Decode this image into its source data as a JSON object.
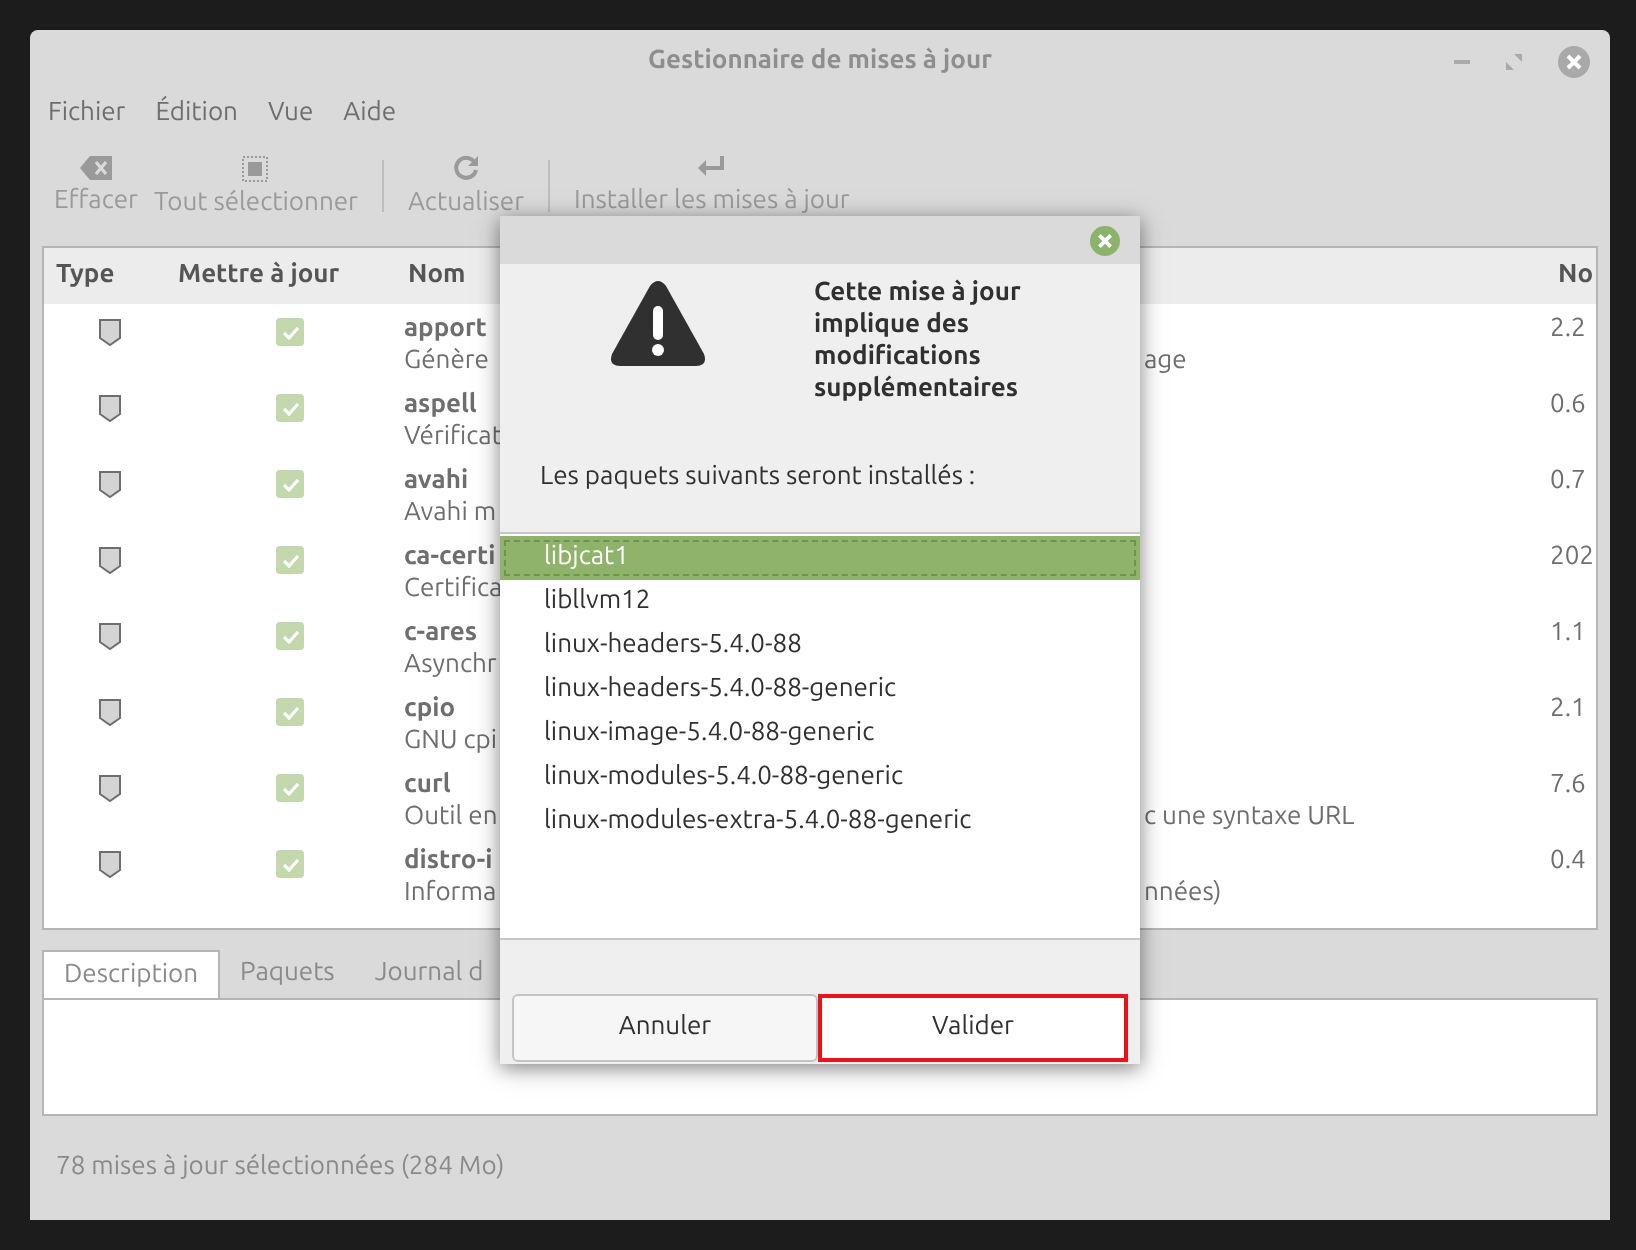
{
  "window": {
    "title": "Gestionnaire de mises à jour"
  },
  "menu": [
    "Fichier",
    "Édition",
    "Vue",
    "Aide"
  ],
  "toolbar": [
    "Effacer",
    "Tout sélectionner",
    "Actualiser",
    "Installer les mises à jour"
  ],
  "table": {
    "columns": [
      "Type",
      "Mettre à jour",
      "Nom",
      "No"
    ],
    "rows": [
      {
        "name": "apport",
        "description": "Génère",
        "description_tail": "age",
        "version": "2.2",
        "checked": true
      },
      {
        "name": "aspell",
        "description": "Vérificat",
        "version": "0.6",
        "checked": true
      },
      {
        "name": "avahi",
        "description": "Avahi m",
        "version": "0.7",
        "checked": true
      },
      {
        "name": "ca-certi",
        "description": "Certifica",
        "version": "202",
        "checked": true
      },
      {
        "name": "c-ares",
        "description": "Asynchr",
        "version": "1.1",
        "checked": true
      },
      {
        "name": "cpio",
        "description": "GNU cpi",
        "version": "2.1",
        "checked": true
      },
      {
        "name": "curl",
        "description": "Outil en",
        "description_tail": "c une syntaxe URL",
        "version": "7.6",
        "checked": true
      },
      {
        "name": "distro-i",
        "description": "Informa",
        "description_tail": "nnées)",
        "version": "0.4",
        "checked": true
      }
    ]
  },
  "tabs": [
    {
      "label": "Description",
      "selected": true
    },
    {
      "label": "Paquets",
      "selected": false
    },
    {
      "label": "Journal d",
      "selected": false
    }
  ],
  "status_bar": "78 mises à jour sélectionnées (284 Mo)",
  "dialog": {
    "title": "Cette mise à jour implique des modifications supplémentaires",
    "label": "Les paquets suivants seront installés :",
    "packages": [
      {
        "name": "libjcat1",
        "selected": true
      },
      {
        "name": "libllvm12",
        "selected": false
      },
      {
        "name": "linux-headers-5.4.0-88",
        "selected": false
      },
      {
        "name": "linux-headers-5.4.0-88-generic",
        "selected": false
      },
      {
        "name": "linux-image-5.4.0-88-generic",
        "selected": false
      },
      {
        "name": "linux-modules-5.4.0-88-generic",
        "selected": false
      },
      {
        "name": "linux-modules-extra-5.4.0-88-generic",
        "selected": false
      }
    ],
    "buttons": [
      {
        "label": "Annuler",
        "highlighted": false
      },
      {
        "label": "Valider",
        "highlighted": true
      }
    ]
  }
}
